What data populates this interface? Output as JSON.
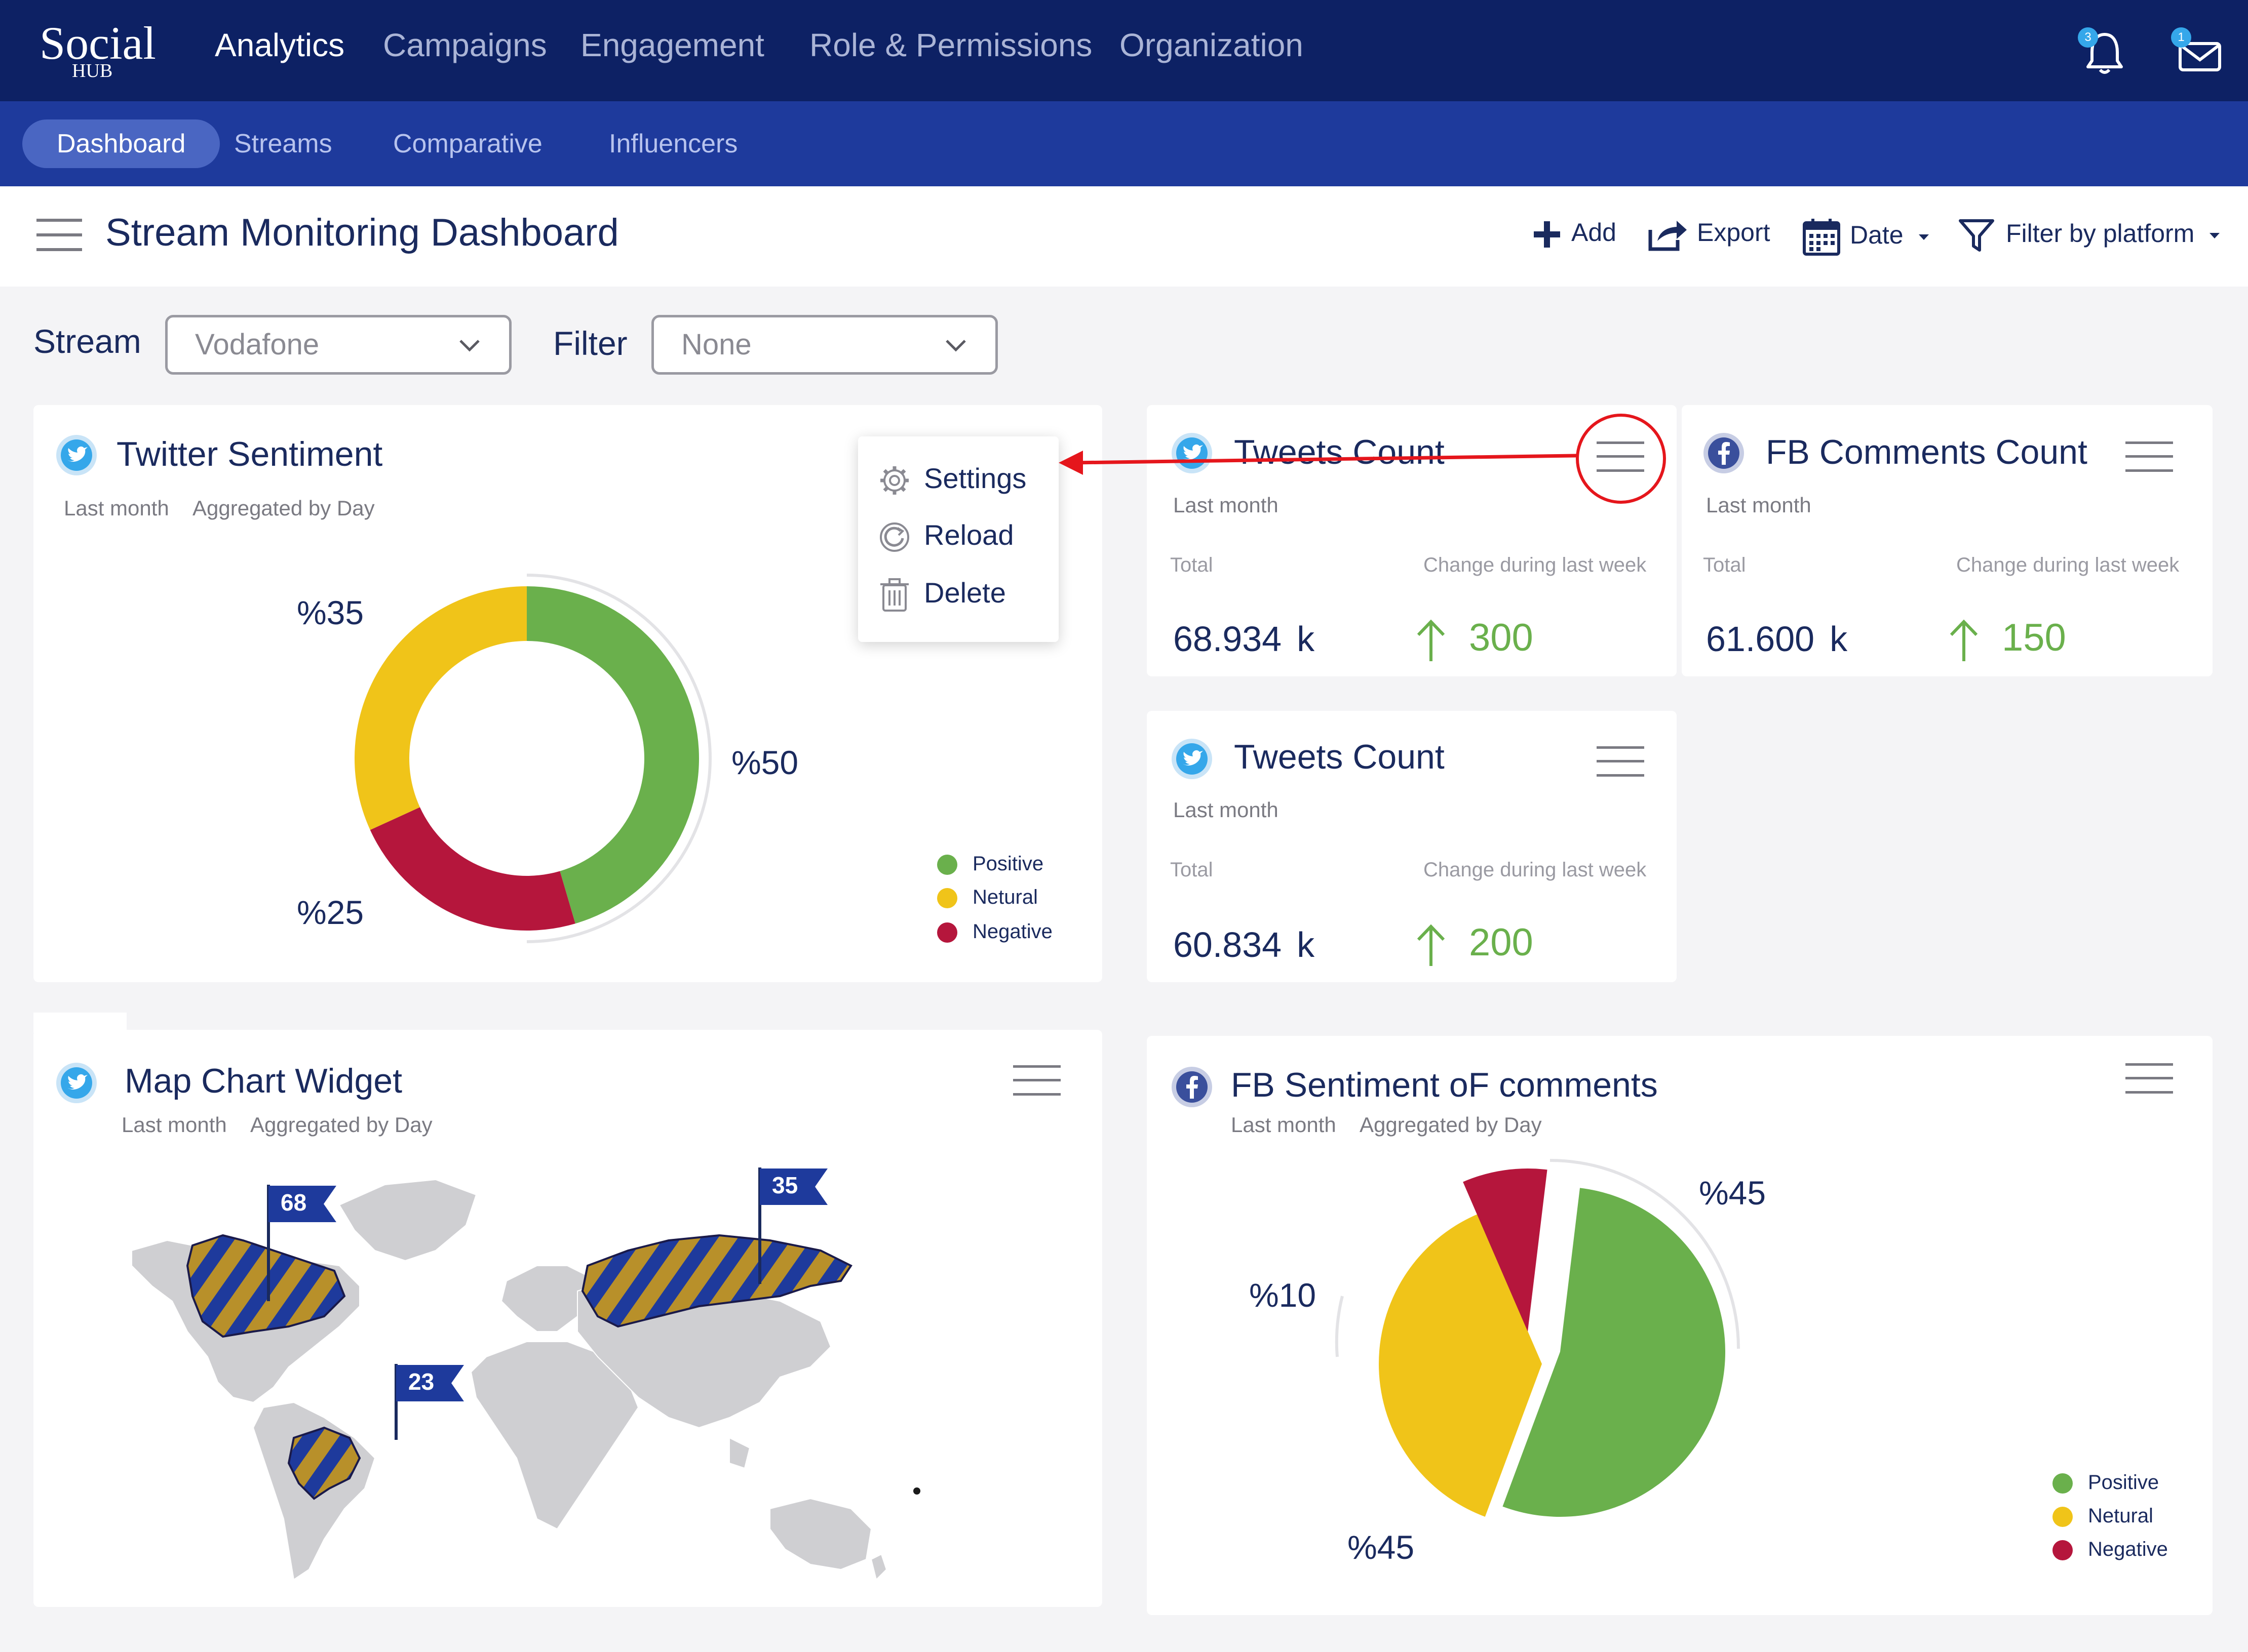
{
  "app": {
    "logo_main": "Social",
    "logo_sub": "HUB"
  },
  "topnav": {
    "items": [
      "Analytics",
      "Campaigns",
      "Engagement",
      "Role & Permissions",
      "Organization"
    ],
    "active": "Analytics",
    "notifications_badge": "3",
    "messages_badge": "1"
  },
  "subnav": {
    "items": [
      "Dashboard",
      "Streams",
      "Comparative",
      "Influencers"
    ],
    "active": "Dashboard"
  },
  "header": {
    "title": "Stream Monitoring Dashboard",
    "actions": {
      "add": "Add",
      "export": "Export",
      "date": "Date",
      "filter": "Filter by platform"
    }
  },
  "filters": {
    "stream_label": "Stream",
    "stream_value": "Vodafone",
    "filter_label": "Filter",
    "filter_value": "None"
  },
  "twitter_sentiment": {
    "title": "Twitter Sentiment",
    "period": "Last month",
    "aggregation": "Aggregated by Day",
    "labels": {
      "positive": "%50",
      "neutral": "%35",
      "negative": "%25"
    },
    "menu": {
      "settings": "Settings",
      "reload": "Reload",
      "delete": "Delete"
    }
  },
  "tweets_count_1": {
    "title": "Tweets Count",
    "period": "Last month",
    "total_label": "Total",
    "change_label": "Change during last week",
    "total": "68.934",
    "unit": "k",
    "change": "300"
  },
  "fb_comments_count": {
    "title": "FB Comments Count",
    "period": "Last month",
    "total_label": "Total",
    "change_label": "Change during last week",
    "total": "61.600",
    "unit": "k",
    "change": "150"
  },
  "tweets_count_2": {
    "title": "Tweets Count",
    "period": "Last month",
    "total_label": "Total",
    "change_label": "Change during last week",
    "total": "60.834",
    "unit": "k",
    "change": "200"
  },
  "map_widget": {
    "title": "Map Chart Widget",
    "period": "Last month",
    "aggregation": "Aggregated by Day",
    "markers": {
      "north_america": "68",
      "russia": "35",
      "brazil": "23"
    }
  },
  "fb_sentiment": {
    "title": "FB Sentiment oF comments",
    "period": "Last month",
    "aggregation": "Aggregated by Day",
    "labels": {
      "positive": "%45",
      "neutral": "%45",
      "negative": "%10"
    }
  },
  "legend": {
    "positive": "Positive",
    "neutral": "Netural",
    "negative": "Negative"
  },
  "colors": {
    "navy": "#0d2164",
    "subnav": "#1e3a9c",
    "positive": "#6ab04c",
    "neutral": "#f0c419",
    "negative": "#b5163c",
    "map_highlight": "#b8902a",
    "stripe": "#1e3a9c",
    "annotation": "#e5161c"
  },
  "chart_data": [
    {
      "type": "pie",
      "categories": [
        "Positive",
        "Netural",
        "Negative"
      ],
      "values": [
        50,
        35,
        25
      ],
      "title": "Twitter Sentiment"
    },
    {
      "type": "pie",
      "categories": [
        "Positive",
        "Netural",
        "Negative"
      ],
      "values": [
        45,
        45,
        10
      ],
      "title": "FB Sentiment oF comments"
    }
  ]
}
